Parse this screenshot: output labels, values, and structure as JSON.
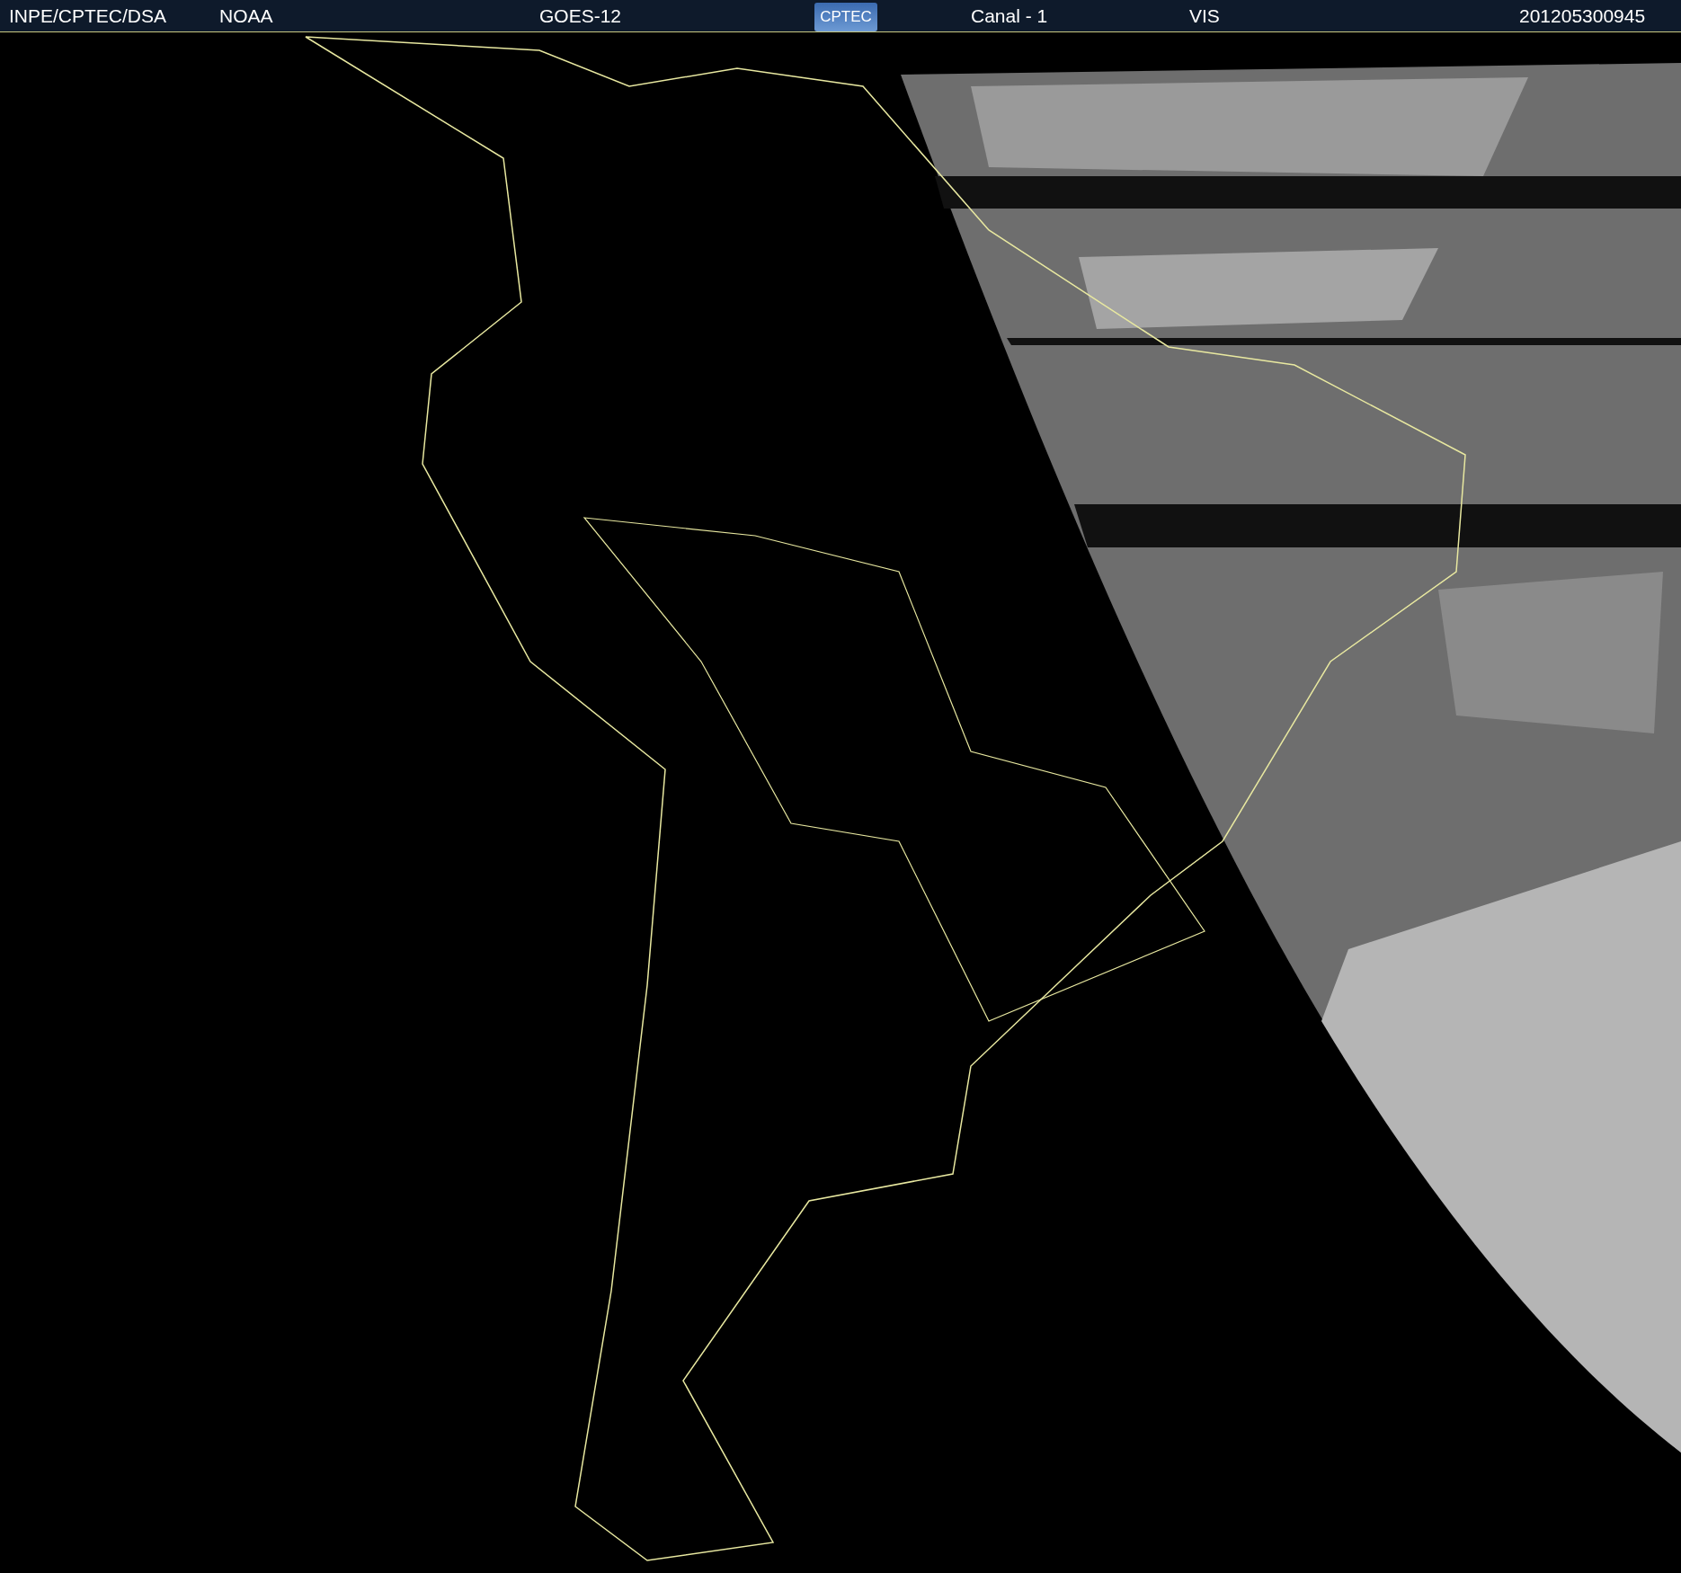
{
  "header": {
    "items": [
      {
        "kind": "text",
        "text": "INPE/CPTEC/DSA"
      },
      {
        "kind": "text",
        "text": "NOAA"
      },
      {
        "kind": "text",
        "text": "GOES-12"
      },
      {
        "kind": "logo",
        "text": "CPTEC"
      },
      {
        "kind": "text",
        "text": "Canal - 1"
      },
      {
        "kind": "text",
        "text": "VIS"
      },
      {
        "kind": "text",
        "text": "201205300945"
      }
    ]
  }
}
